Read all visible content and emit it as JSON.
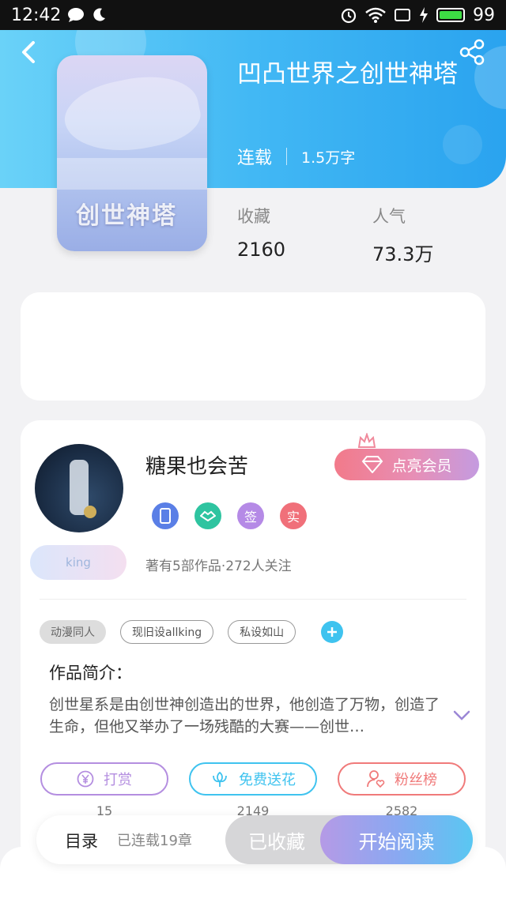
{
  "status_bar": {
    "time": "12:42",
    "battery": "99"
  },
  "book": {
    "title": "凹凸世界之创世神塔",
    "status": "连载",
    "word_count": "1.5万字",
    "cover_text": "创世神塔"
  },
  "stats": {
    "collect_label": "收藏",
    "collect_value": "2160",
    "popularity_label": "人气",
    "popularity_value": "73.3万"
  },
  "author": {
    "name": "糖果也会苦",
    "vip_label": "点亮会员",
    "badges": [
      {
        "name": "phone-badge",
        "text": "",
        "color": "#5a7fe6"
      },
      {
        "name": "handshake-badge",
        "text": "",
        "color": "#2ec4a0"
      },
      {
        "name": "signed-badge",
        "text": "签",
        "color": "#b58ae6"
      },
      {
        "name": "verified-badge",
        "text": "实",
        "color": "#f0707a"
      }
    ],
    "level_tag": "king",
    "summary": "著有5部作品·272人关注"
  },
  "tags": [
    "动漫同人",
    "现旧设allking",
    "私设如山"
  ],
  "intro": {
    "heading": "作品简介：",
    "text": "创世星系是由创世神创造出的世界，他创造了万物，创造了生命，但他又举办了一场残酷的大赛——创世…"
  },
  "actions": [
    {
      "label": "打赏",
      "count": "15",
      "color": "#b48ee0"
    },
    {
      "label": "免费送花",
      "count": "2149",
      "color": "#3fc3ef"
    },
    {
      "label": "粉丝榜",
      "count": "2582",
      "color": "#f07a7a"
    }
  ],
  "bottom": {
    "toc_label": "目录",
    "toc_sub": "已连载19章",
    "collected_label": "已收藏",
    "read_label": "开始阅读"
  }
}
